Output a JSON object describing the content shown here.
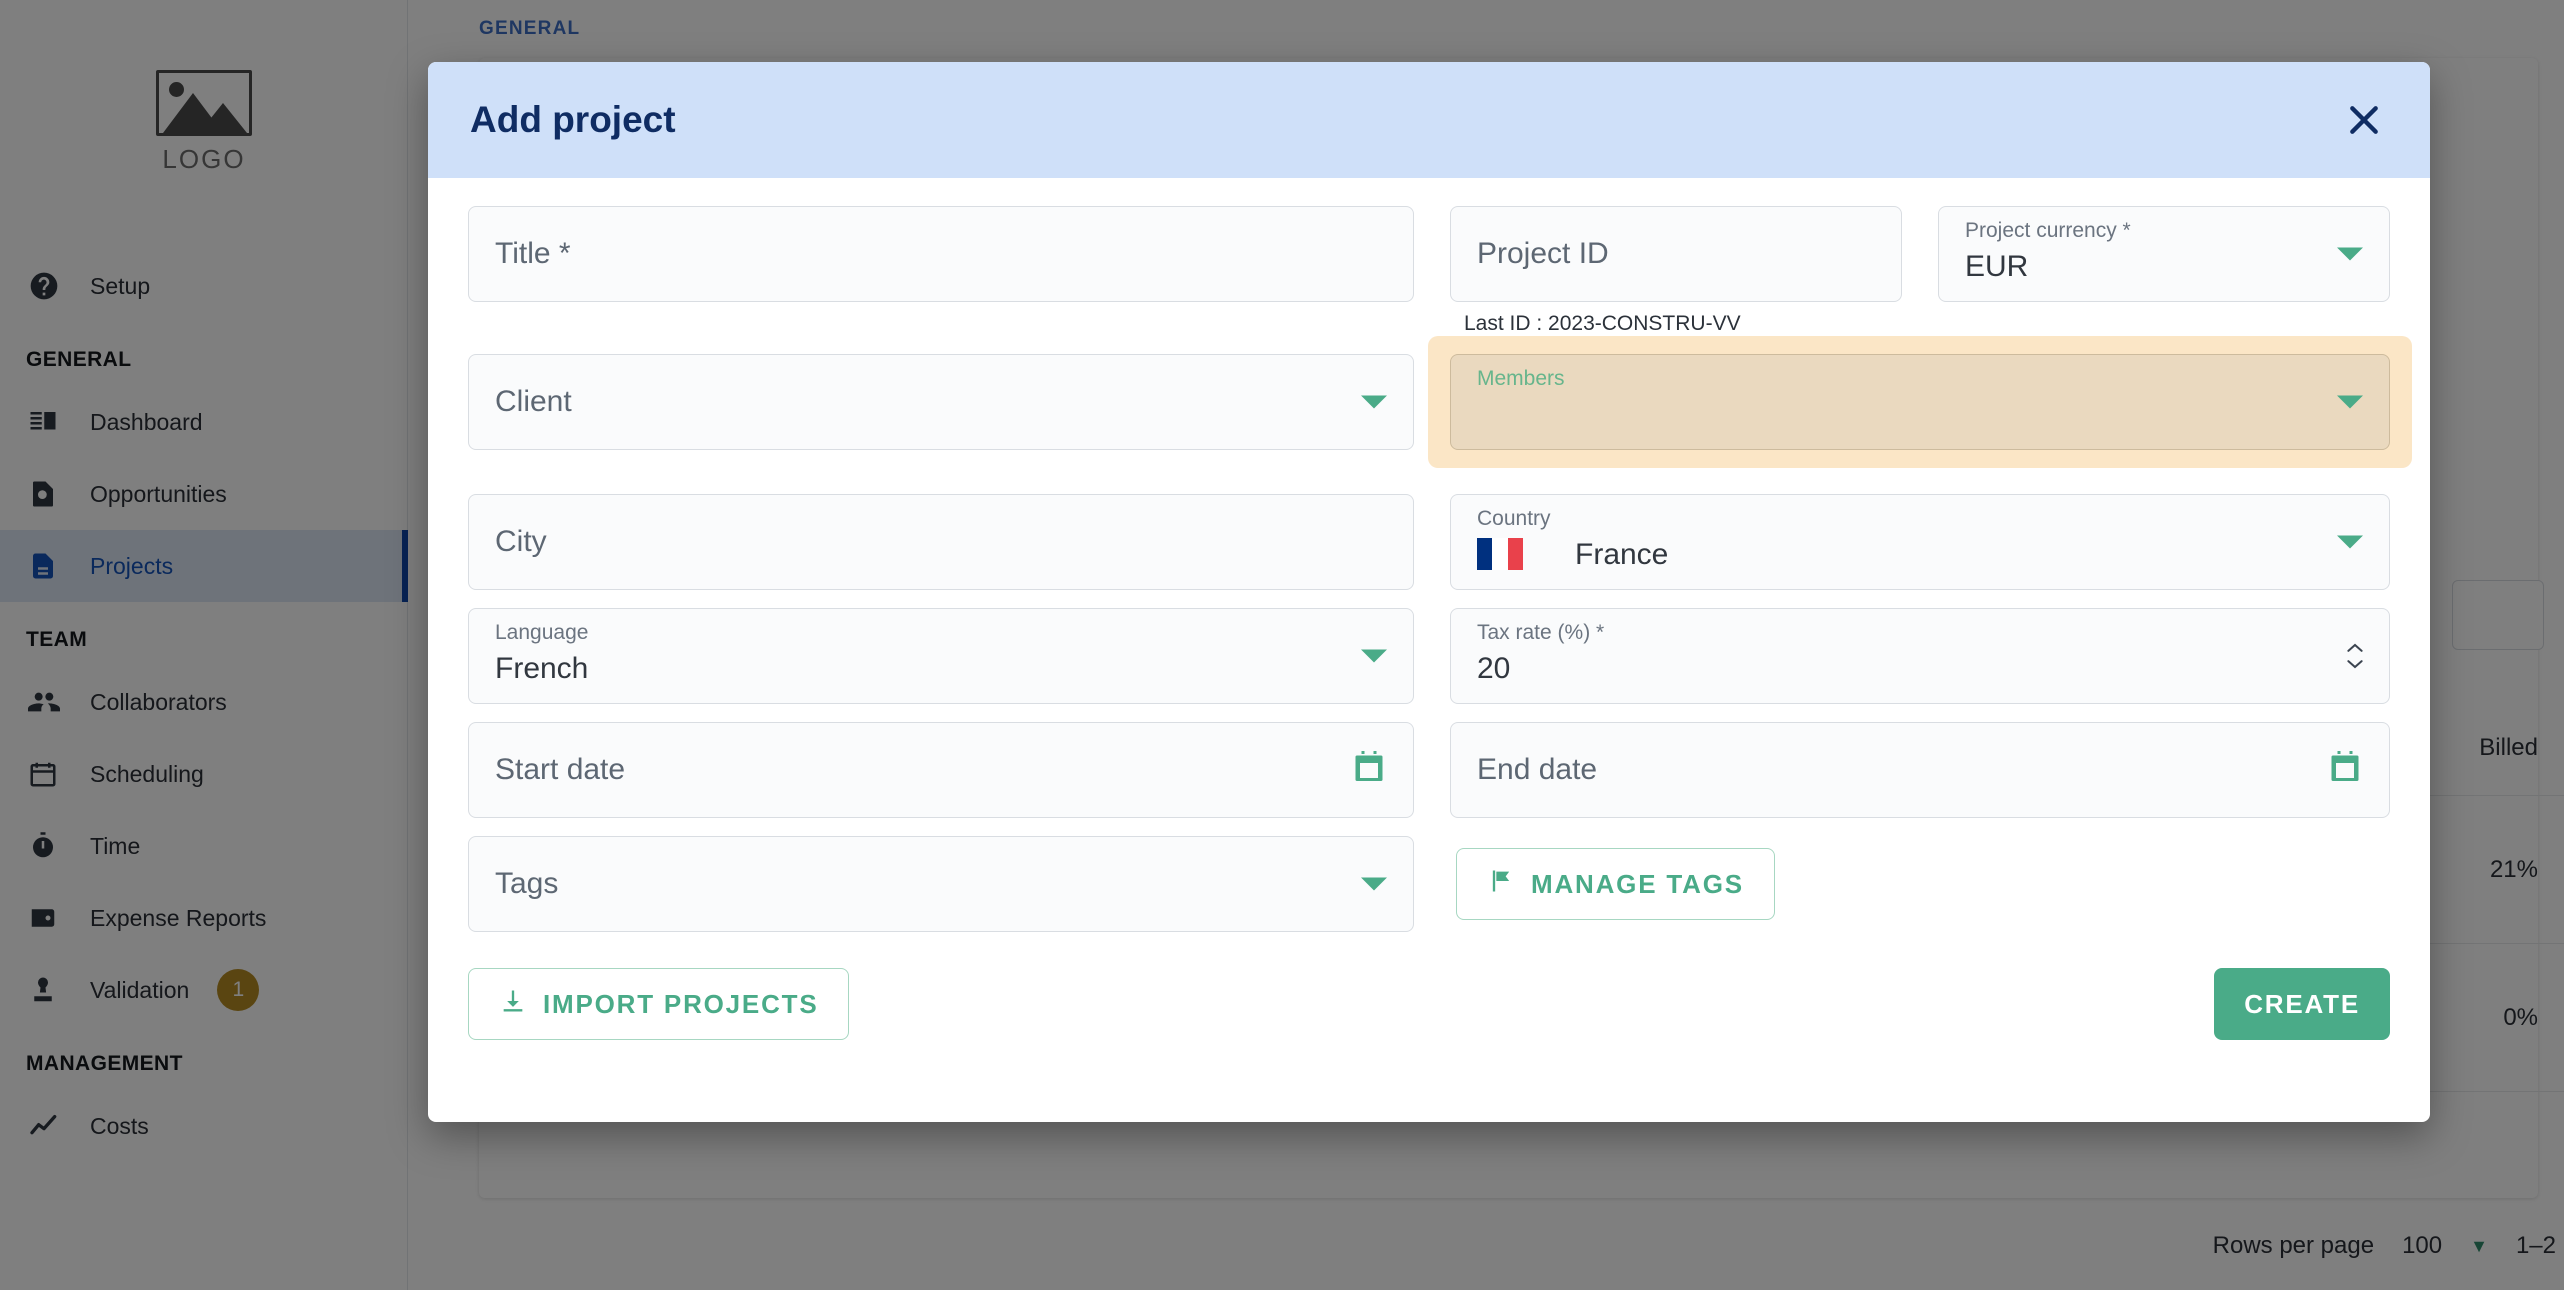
{
  "app": {
    "logo_text": "LOGO",
    "breadcrumb": "GENERAL",
    "sidebar": {
      "top_items": [
        {
          "label": "Setup",
          "icon": "help-circle-icon"
        }
      ],
      "sections": [
        {
          "title": "GENERAL",
          "items": [
            {
              "label": "Dashboard",
              "icon": "dashboard-icon",
              "active": false
            },
            {
              "label": "Opportunities",
              "icon": "opportunity-search-icon",
              "active": false
            },
            {
              "label": "Projects",
              "icon": "document-icon",
              "active": true
            }
          ]
        },
        {
          "title": "TEAM",
          "items": [
            {
              "label": "Collaborators",
              "icon": "people-icon",
              "active": false
            },
            {
              "label": "Scheduling",
              "icon": "calendar-icon",
              "active": false
            },
            {
              "label": "Time",
              "icon": "stopwatch-icon",
              "active": false
            },
            {
              "label": "Expense Reports",
              "icon": "wallet-icon",
              "active": false
            },
            {
              "label": "Validation",
              "icon": "stamp-icon",
              "active": false,
              "badge": "1"
            }
          ]
        },
        {
          "title": "MANAGEMENT",
          "items": [
            {
              "label": "Costs",
              "icon": "trend-line-icon",
              "active": false
            }
          ]
        }
      ]
    },
    "table": {
      "headers": [
        "Billed"
      ],
      "rows": [
        [
          "21%"
        ],
        [
          "0%"
        ]
      ]
    },
    "pagination": {
      "rows_per_page_label": "Rows per page",
      "rows_per_page_value": "100",
      "range_label": "1–2"
    }
  },
  "modal": {
    "title": "Add project",
    "close_icon": "close-icon",
    "fields": {
      "title": {
        "placeholder": "Title *"
      },
      "project_id": {
        "placeholder": "Project ID",
        "hint": "Last ID : 2023-CONSTRU-VV"
      },
      "project_currency": {
        "label": "Project currency *",
        "value": "EUR"
      },
      "client": {
        "placeholder": "Client"
      },
      "members": {
        "placeholder": "Members"
      },
      "city": {
        "placeholder": "City"
      },
      "country": {
        "label": "Country",
        "value": "France",
        "flag": "france-flag-icon"
      },
      "language": {
        "label": "Language",
        "value": "French"
      },
      "tax_rate": {
        "label": "Tax rate (%) *",
        "value": "20"
      },
      "start_date": {
        "placeholder": "Start date",
        "icon": "calendar-icon"
      },
      "end_date": {
        "placeholder": "End date",
        "icon": "calendar-icon"
      },
      "tags": {
        "placeholder": "Tags"
      }
    },
    "buttons": {
      "manage_tags": {
        "label": "MANAGE TAGS",
        "icon": "flag-icon"
      },
      "import_projects": {
        "label": "IMPORT PROJECTS",
        "icon": "download-icon"
      },
      "create": {
        "label": "CREATE"
      }
    }
  },
  "colors": {
    "accent_green": "#4aab88",
    "header_blue": "#cfe0f9",
    "title_navy": "#0f2c63",
    "highlight_tan": "#fbe6c6",
    "badge_gold": "#b58a22",
    "active_nav_blue": "#1552b8"
  }
}
